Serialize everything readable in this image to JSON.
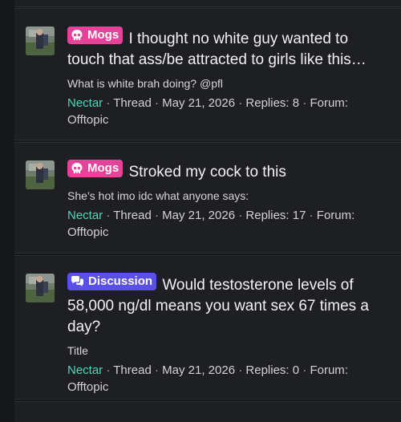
{
  "threads": [
    {
      "tag": "Mogs",
      "title": "I thought no white guy wanted to touch that ass/be attracted to girls like this…",
      "snippet": "What is white brah doing? @pfl",
      "author": "Nectar",
      "type": "Thread",
      "date": "May 21, 2026",
      "replies_label": "Replies: 8",
      "forum_label": "Forum:",
      "forum": "Offtopic"
    },
    {
      "tag": "Mogs",
      "title": "Stroked my cock to this",
      "snippet": "She’s hot imo idc what anyone says:",
      "author": "Nectar",
      "type": "Thread",
      "date": "May 21, 2026",
      "replies_label": "Replies: 17",
      "forum_label": "Forum:",
      "forum": "Offtopic"
    },
    {
      "tag": "Discussion",
      "title": "Would testosterone levels of 58,000 ng/dl means you want sex 67 times a day?",
      "snippet": "Title",
      "author": "Nectar",
      "type": "Thread",
      "date": "May 21, 2026",
      "replies_label": "Replies: 0",
      "forum_label": "Forum:",
      "forum": "Offtopic"
    }
  ],
  "colors": {
    "page_bg": "#16171a",
    "panel_bg": "#1e1f23",
    "mogs_tag": "#e5439a",
    "discussion_tag": "#5a4fe6",
    "author_link": "#57d3b9"
  },
  "icons": {
    "mogs_tag": "skull-icon",
    "discussion_tag": "chat-bubbles-icon"
  }
}
